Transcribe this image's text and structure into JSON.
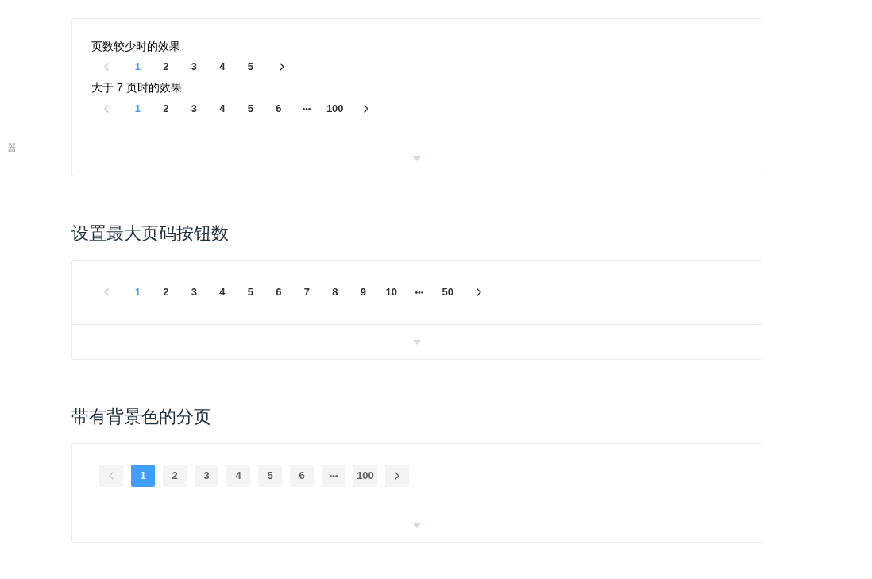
{
  "sidebar": {
    "items": [
      {
        "label": "器"
      }
    ]
  },
  "sections": [
    {
      "demo": {
        "examples": [
          {
            "label": "页数较少时的效果",
            "pagination": {
              "background": false,
              "prev": {
                "disabled": true
              },
              "items": [
                {
                  "kind": "page",
                  "label": "1",
                  "selected": true
                },
                {
                  "kind": "page",
                  "label": "2",
                  "selected": false
                },
                {
                  "kind": "page",
                  "label": "3",
                  "selected": false
                },
                {
                  "kind": "page",
                  "label": "4",
                  "selected": false
                },
                {
                  "kind": "page",
                  "label": "5",
                  "selected": false
                }
              ],
              "next": {
                "disabled": false
              }
            }
          },
          {
            "label": "大于 7 页时的效果",
            "pagination": {
              "background": false,
              "prev": {
                "disabled": true
              },
              "items": [
                {
                  "kind": "page",
                  "label": "1",
                  "selected": true
                },
                {
                  "kind": "page",
                  "label": "2",
                  "selected": false
                },
                {
                  "kind": "page",
                  "label": "3",
                  "selected": false
                },
                {
                  "kind": "page",
                  "label": "4",
                  "selected": false
                },
                {
                  "kind": "page",
                  "label": "5",
                  "selected": false
                },
                {
                  "kind": "page",
                  "label": "6",
                  "selected": false
                },
                {
                  "kind": "ellipsis",
                  "selected": false
                },
                {
                  "kind": "page",
                  "label": "100",
                  "selected": false
                }
              ],
              "next": {
                "disabled": false
              }
            }
          }
        ]
      }
    },
    {
      "heading": "设置最大页码按钮数",
      "demo": {
        "examples": [
          {
            "pagination": {
              "background": false,
              "prev": {
                "disabled": true
              },
              "items": [
                {
                  "kind": "page",
                  "label": "1",
                  "selected": true
                },
                {
                  "kind": "page",
                  "label": "2",
                  "selected": false
                },
                {
                  "kind": "page",
                  "label": "3",
                  "selected": false
                },
                {
                  "kind": "page",
                  "label": "4",
                  "selected": false
                },
                {
                  "kind": "page",
                  "label": "5",
                  "selected": false
                },
                {
                  "kind": "page",
                  "label": "6",
                  "selected": false
                },
                {
                  "kind": "page",
                  "label": "7",
                  "selected": false
                },
                {
                  "kind": "page",
                  "label": "8",
                  "selected": false
                },
                {
                  "kind": "page",
                  "label": "9",
                  "selected": false
                },
                {
                  "kind": "page",
                  "label": "10",
                  "selected": false
                },
                {
                  "kind": "ellipsis",
                  "selected": false
                },
                {
                  "kind": "page",
                  "label": "50",
                  "selected": false
                }
              ],
              "next": {
                "disabled": false
              }
            }
          }
        ]
      }
    },
    {
      "heading": "带有背景色的分页",
      "demo": {
        "examples": [
          {
            "pagination": {
              "background": true,
              "prev": {
                "disabled": true
              },
              "items": [
                {
                  "kind": "page",
                  "label": "1",
                  "selected": true
                },
                {
                  "kind": "page",
                  "label": "2",
                  "selected": false
                },
                {
                  "kind": "page",
                  "label": "3",
                  "selected": false
                },
                {
                  "kind": "page",
                  "label": "4",
                  "selected": false
                },
                {
                  "kind": "page",
                  "label": "5",
                  "selected": false
                },
                {
                  "kind": "page",
                  "label": "6",
                  "selected": false
                },
                {
                  "kind": "ellipsis",
                  "selected": false
                },
                {
                  "kind": "page",
                  "label": "100",
                  "selected": false
                }
              ],
              "next": {
                "disabled": false
              }
            }
          }
        ]
      }
    }
  ]
}
